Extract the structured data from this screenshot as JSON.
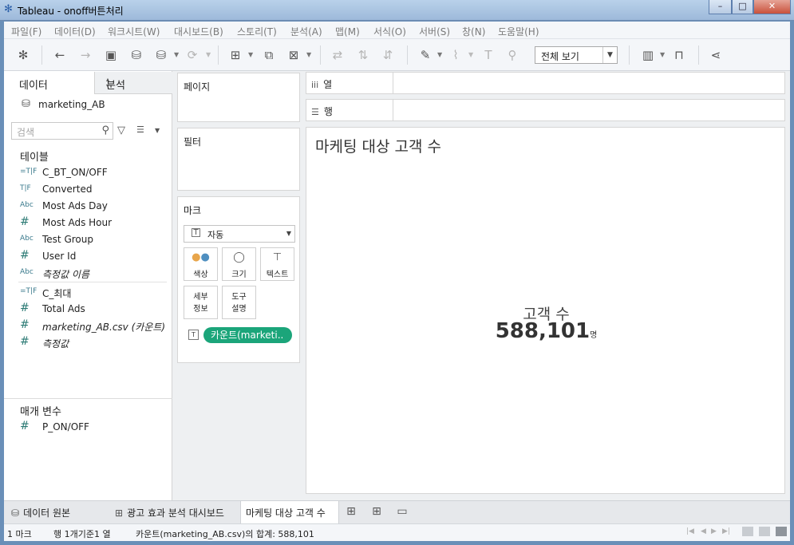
{
  "window": {
    "title": "Tableau - onoff버튼처리",
    "controls": {
      "minimize": "–",
      "maximize": "□",
      "close": "✕"
    }
  },
  "menu": [
    "파일(F)",
    "데이터(D)",
    "워크시트(W)",
    "대시보드(B)",
    "스토리(T)",
    "분석(A)",
    "맵(M)",
    "서식(O)",
    "서버(S)",
    "창(N)",
    "도움말(H)"
  ],
  "toolbar": {
    "view_select": "전체 보기"
  },
  "left_panel": {
    "tabs": {
      "data": "데이터",
      "analysis": "분석"
    },
    "datasource": "marketing_AB",
    "search_placeholder": "검색",
    "tables_header": "테이블",
    "fields": [
      {
        "icon": "=T|F",
        "name": "C_BT_ON/OFF",
        "italic": false
      },
      {
        "icon": "T|F",
        "name": "Converted",
        "italic": false
      },
      {
        "icon": "Abc",
        "name": "Most Ads Day",
        "italic": false
      },
      {
        "icon": "#",
        "name": "Most Ads Hour",
        "italic": false
      },
      {
        "icon": "Abc",
        "name": "Test Group",
        "italic": false
      },
      {
        "icon": "#",
        "name": "User Id",
        "italic": false
      },
      {
        "icon": "Abc",
        "name": "측정값 이름",
        "italic": true
      },
      {
        "icon": "=T|F",
        "name": "C_최대",
        "italic": false
      },
      {
        "icon": "#",
        "name": "Total Ads",
        "italic": false
      },
      {
        "icon": "#",
        "name": "marketing_AB.csv (카운트)",
        "italic": true
      },
      {
        "icon": "#",
        "name": "측정값",
        "italic": true
      }
    ],
    "params_header": "매개 변수",
    "params": [
      {
        "icon": "#",
        "name": "P_ON/OFF"
      }
    ]
  },
  "cards": {
    "pages": "페이지",
    "filters": "필터",
    "marks": "마크",
    "mark_type": "자동",
    "mark_buttons": {
      "color": "색상",
      "size": "크기",
      "text": "텍스트",
      "detail": "세부\n정보",
      "tooltip": "도구\n설명"
    },
    "pill": "카운트(marketi.."
  },
  "shelves": {
    "columns": "열",
    "rows": "행"
  },
  "sheet": {
    "title": "마케팅 대상 고객 수",
    "kpi_label": "고객 수",
    "kpi_value": "588,101",
    "kpi_unit": "명"
  },
  "sheet_tabs": [
    {
      "label": "데이터 원본",
      "icon": "datasource-icon",
      "active": false
    },
    {
      "label": "광고 효과 분석 대시보드",
      "icon": "dashboard-icon",
      "active": false
    },
    {
      "label": "마케팅 대상 고객 수",
      "icon": "",
      "active": true
    }
  ],
  "status": {
    "marks": "1 마크",
    "rows_cols": "행 1개기준1 열",
    "sum": "카운트(marketing_AB.csv)의 합계: 588,101"
  },
  "colors": {
    "pill": "#1ba57a",
    "titlebar": "#b9d1ea",
    "panel_bg": "#eef0f2"
  }
}
